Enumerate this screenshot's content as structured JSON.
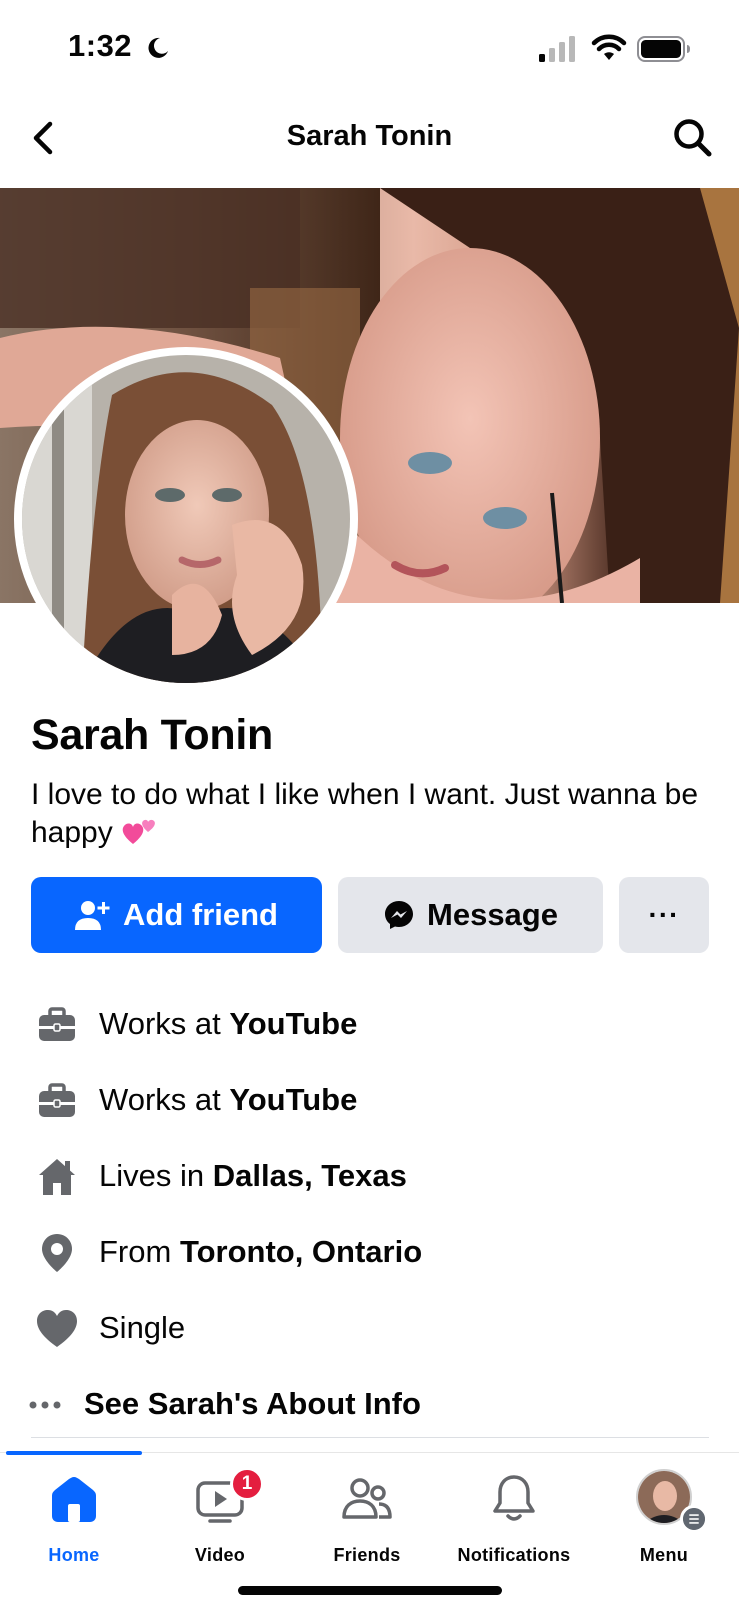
{
  "status_bar": {
    "time": "1:32",
    "icons": [
      "moon-icon",
      "cellular-signal-icon",
      "wifi-icon",
      "battery-icon"
    ]
  },
  "header": {
    "title": "Sarah Tonin",
    "back_icon": "chevron-left-icon",
    "search_icon": "search-icon"
  },
  "profile": {
    "name": "Sarah Tonin",
    "bio": "I love to do what I like when I want. Just wanna be happy",
    "bio_emoji": "two-hearts-emoji",
    "cover_photo": "cover-photo",
    "avatar": "profile-photo"
  },
  "actions": {
    "add_friend": "Add friend",
    "message": "Message",
    "more": "···"
  },
  "details": [
    {
      "icon": "briefcase-icon",
      "prefix": "Works at ",
      "value": "YouTube"
    },
    {
      "icon": "briefcase-icon",
      "prefix": "Works at ",
      "value": "YouTube"
    },
    {
      "icon": "home-icon",
      "prefix": "Lives in ",
      "value": "Dallas, Texas"
    },
    {
      "icon": "location-pin-icon",
      "prefix": "From ",
      "value": "Toronto, Ontario"
    },
    {
      "icon": "heart-icon",
      "prefix": "",
      "value": "Single"
    }
  ],
  "about_link": {
    "icon": "more-horizontal-icon",
    "label": "See Sarah's About Info"
  },
  "tabbar": {
    "tabs": [
      {
        "label": "Home",
        "icon": "home-icon",
        "active": true
      },
      {
        "label": "Video",
        "icon": "video-icon",
        "badge": "1"
      },
      {
        "label": "Friends",
        "icon": "friends-icon"
      },
      {
        "label": "Notifications",
        "icon": "bell-icon"
      },
      {
        "label": "Menu",
        "icon": "menu-avatar"
      }
    ]
  },
  "colors": {
    "accent": "#0866ff",
    "secondary_button": "#e4e6eb",
    "icon_gray": "#65676b",
    "badge": "#e41e3f"
  }
}
